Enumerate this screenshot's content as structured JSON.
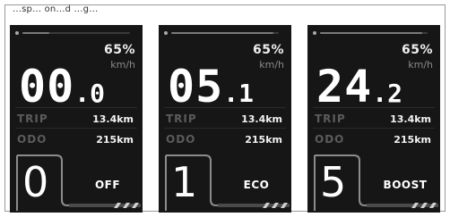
{
  "header": {
    "text": "...sp... on...d ...g..."
  },
  "screens": [
    {
      "battery": "65%",
      "unit": "km/h",
      "speed_int": "00",
      "speed_dec": ".0",
      "trip_label": "TRIP",
      "trip_value": "13.4km",
      "odo_label": "ODO",
      "odo_value": "215km",
      "assist_level": "0",
      "assist_mode": "OFF",
      "progress": 0.25
    },
    {
      "battery": "65%",
      "unit": "km/h",
      "speed_int": "05",
      "speed_dec": ".1",
      "trip_label": "TRIP",
      "trip_value": "13.4km",
      "odo_label": "ODO",
      "odo_value": "215km",
      "assist_level": "1",
      "assist_mode": "ECO",
      "progress": 0.95
    },
    {
      "battery": "65%",
      "unit": "km/h",
      "speed_int": "24",
      "speed_dec": ".2",
      "trip_label": "TRIP",
      "trip_value": "13.4km",
      "odo_label": "ODO",
      "odo_value": "215km",
      "assist_level": "5",
      "assist_mode": "BOOST",
      "progress": 0.95
    }
  ]
}
